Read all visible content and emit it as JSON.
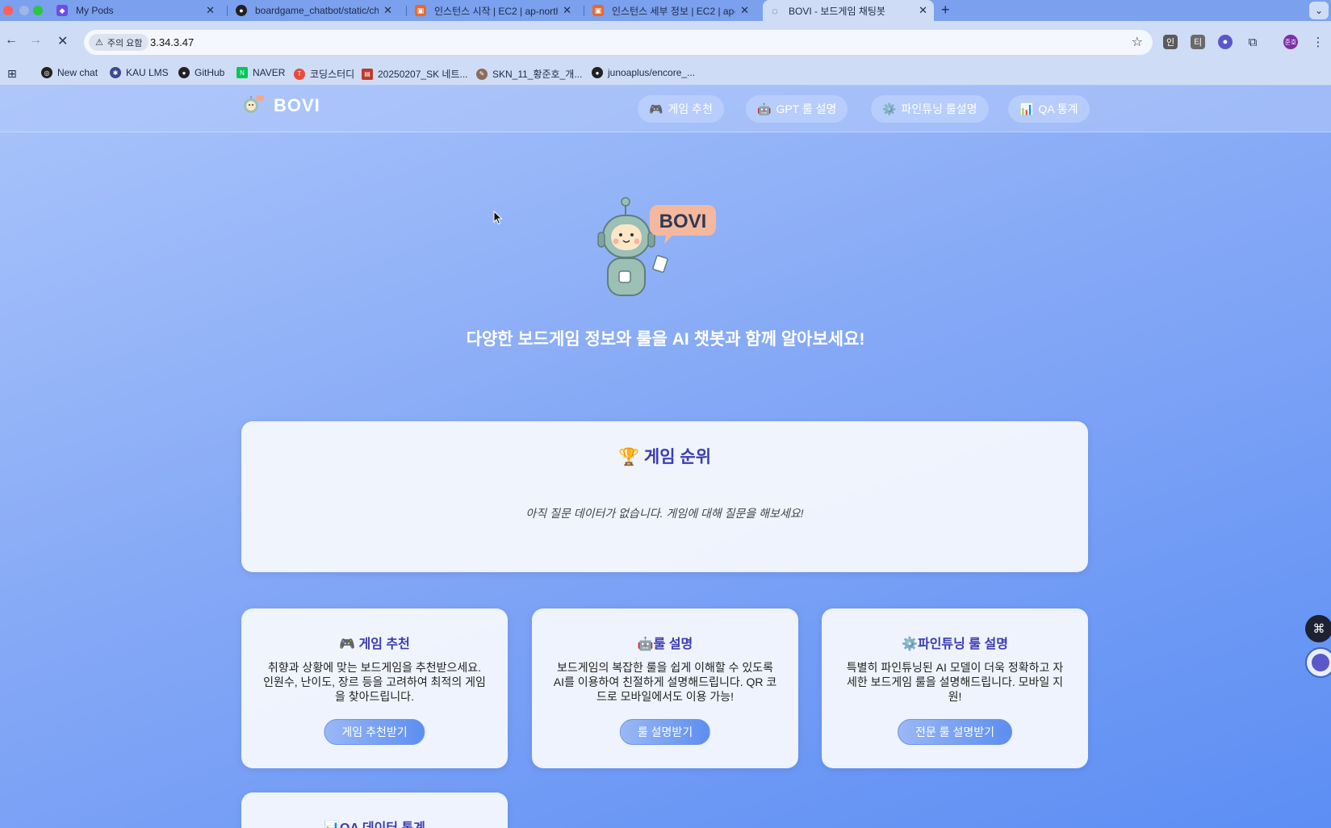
{
  "browser": {
    "tabs": [
      {
        "title": "My Pods",
        "icon": "cube-icon",
        "color": "#6c4ee0"
      },
      {
        "title": "boardgame_chatbot/static/ch",
        "icon": "github-icon",
        "color": "#222222"
      },
      {
        "title": "인스턴스 시작 | EC2 | ap-northe",
        "icon": "aws-icon",
        "color": "#e8692c"
      },
      {
        "title": "인스턴스 세부 정보 | EC2 | ap-no",
        "icon": "aws-icon",
        "color": "#e8692c"
      },
      {
        "title": "BOVI - 보드게임 채팅봇",
        "icon": "loading-icon",
        "color": "#555555"
      }
    ],
    "address": {
      "security_label": "주의 요함",
      "url": "3.34.3.47"
    },
    "toolbar_icons": [
      "인",
      "티"
    ],
    "profile_label": "준호",
    "bookmarks": [
      {
        "label": "New chat",
        "icon": "openai-icon",
        "color": "#222222"
      },
      {
        "label": "KAU LMS",
        "icon": "kau-icon",
        "color": "#3b4a8c"
      },
      {
        "label": "GitHub",
        "icon": "github-icon",
        "color": "#222222"
      },
      {
        "label": "NAVER",
        "icon": "naver-icon",
        "color": "#03c75a"
      },
      {
        "label": "코딩스터디",
        "icon": "study-icon",
        "color": "#e84a3a"
      },
      {
        "label": "20250207_SK 네트...",
        "icon": "doc-icon",
        "color": "#c0392b"
      },
      {
        "label": "SKN_11_황준호_개...",
        "icon": "notion-icon",
        "color": "#8a6d5a"
      },
      {
        "label": "junoaplus/encore_...",
        "icon": "github-icon",
        "color": "#222222"
      }
    ]
  },
  "site": {
    "brand": "BOVI",
    "nav": [
      {
        "icon": "🎮",
        "label": "게임 추천"
      },
      {
        "icon": "🤖",
        "label": "GPT 룰 설명"
      },
      {
        "icon": "⚙️",
        "label": "파인튜닝 룰설명"
      },
      {
        "icon": "📊",
        "label": "QA 통계"
      }
    ],
    "mascot_badge": "BOVI",
    "hero_text": "다양한 보드게임 정보와 룰을 AI 챗봇과 함께 알아보세요!",
    "ranking": {
      "title": "🏆 게임 순위",
      "empty_text": "아직 질문 데이터가 없습니다. 게임에 대해 질문을 해보세요!"
    },
    "features": [
      {
        "title": "🎮 게임 추천",
        "desc": "취향과 상황에 맞는 보드게임을 추천받으세요. 인원수, 난이도, 장르 등을 고려하여 최적의 게임을 찾아드립니다.",
        "button": "게임 추천받기"
      },
      {
        "title": "🤖룰 설명",
        "desc": "보드게임의 복잡한 룰을 쉽게 이해할 수 있도록 AI를 이용하여 친절하게 설명해드립니다. QR 코드로 모바일에서도 이용 가능!",
        "button": "룰 설명받기"
      },
      {
        "title": "⚙️파인튜닝 룰 설명",
        "desc": "특별히 파인튜닝된 AI 모델이 더욱 정확하고 자세한 보드게임 룰을 설명해드립니다. 모바일 지원!",
        "button": "전문 룰 설명받기"
      }
    ],
    "qa_card_title": "📊QA 데이터 통계"
  }
}
